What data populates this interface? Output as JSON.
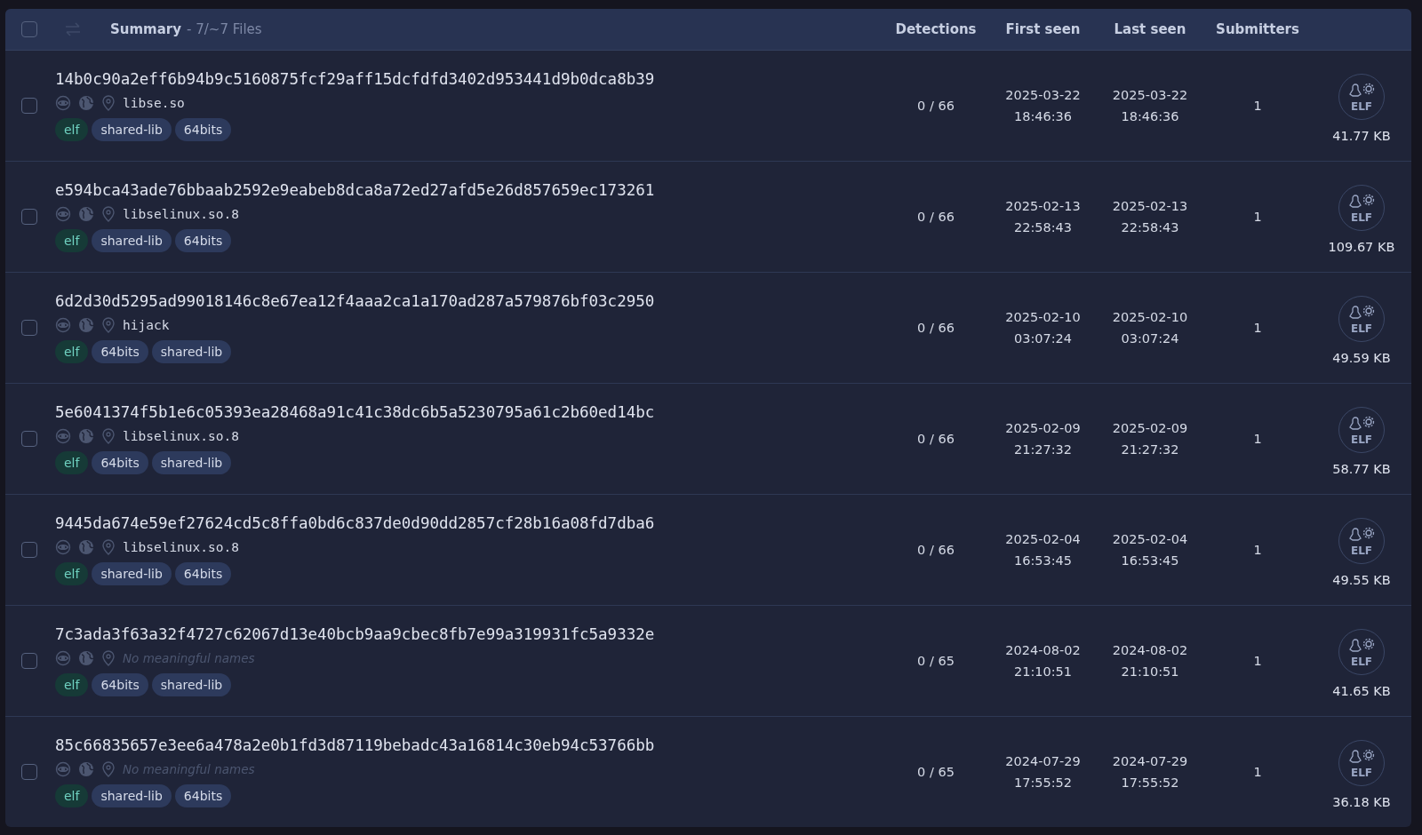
{
  "header": {
    "select_all": {
      "checked": false
    },
    "title": "Summary",
    "count": "- 7/~7 Files",
    "columns": [
      "Detections",
      "First seen",
      "Last seen",
      "Submitters"
    ]
  },
  "rows": [
    {
      "checked": false,
      "hash": "14b0c90a2eff6b94b9c5160875fcf29aff15dcfdfd3402d953441d9b0dca8b39",
      "name": "libse.so",
      "name_missing": false,
      "tags": [
        {
          "label": "elf",
          "kind": "filetype"
        },
        {
          "label": "shared-lib",
          "kind": "tag"
        },
        {
          "label": "64bits",
          "kind": "tag"
        }
      ],
      "detections": "0 / 66",
      "first_seen": [
        "2025-03-22",
        "18:46:36"
      ],
      "last_seen": [
        "2025-03-22",
        "18:46:36"
      ],
      "submitters": "1",
      "file_type": "ELF",
      "size": "41.77 KB"
    },
    {
      "checked": false,
      "hash": "e594bca43ade76bbaab2592e9eabeb8dca8a72ed27afd5e26d857659ec173261",
      "name": "libselinux.so.8",
      "name_missing": false,
      "tags": [
        {
          "label": "elf",
          "kind": "filetype"
        },
        {
          "label": "shared-lib",
          "kind": "tag"
        },
        {
          "label": "64bits",
          "kind": "tag"
        }
      ],
      "detections": "0 / 66",
      "first_seen": [
        "2025-02-13",
        "22:58:43"
      ],
      "last_seen": [
        "2025-02-13",
        "22:58:43"
      ],
      "submitters": "1",
      "file_type": "ELF",
      "size": "109.67 KB"
    },
    {
      "checked": false,
      "hash": "6d2d30d5295ad99018146c8e67ea12f4aaa2ca1a170ad287a579876bf03c2950",
      "name": "hijack",
      "name_missing": false,
      "tags": [
        {
          "label": "elf",
          "kind": "filetype"
        },
        {
          "label": "64bits",
          "kind": "tag"
        },
        {
          "label": "shared-lib",
          "kind": "tag"
        }
      ],
      "detections": "0 / 66",
      "first_seen": [
        "2025-02-10",
        "03:07:24"
      ],
      "last_seen": [
        "2025-02-10",
        "03:07:24"
      ],
      "submitters": "1",
      "file_type": "ELF",
      "size": "49.59 KB"
    },
    {
      "checked": false,
      "hash": "5e6041374f5b1e6c05393ea28468a91c41c38dc6b5a5230795a61c2b60ed14bc",
      "name": "libselinux.so.8",
      "name_missing": false,
      "tags": [
        {
          "label": "elf",
          "kind": "filetype"
        },
        {
          "label": "64bits",
          "kind": "tag"
        },
        {
          "label": "shared-lib",
          "kind": "tag"
        }
      ],
      "detections": "0 / 66",
      "first_seen": [
        "2025-02-09",
        "21:27:32"
      ],
      "last_seen": [
        "2025-02-09",
        "21:27:32"
      ],
      "submitters": "1",
      "file_type": "ELF",
      "size": "58.77 KB"
    },
    {
      "checked": false,
      "hash": "9445da674e59ef27624cd5c8ffa0bd6c837de0d90dd2857cf28b16a08fd7dba6",
      "name": "libselinux.so.8",
      "name_missing": false,
      "tags": [
        {
          "label": "elf",
          "kind": "filetype"
        },
        {
          "label": "shared-lib",
          "kind": "tag"
        },
        {
          "label": "64bits",
          "kind": "tag"
        }
      ],
      "detections": "0 / 66",
      "first_seen": [
        "2025-02-04",
        "16:53:45"
      ],
      "last_seen": [
        "2025-02-04",
        "16:53:45"
      ],
      "submitters": "1",
      "file_type": "ELF",
      "size": "49.55 KB"
    },
    {
      "checked": false,
      "hash": "7c3ada3f63a32f4727c62067d13e40bcb9aa9cbec8fb7e99a319931fc5a9332e",
      "name": "No meaningful names",
      "name_missing": true,
      "tags": [
        {
          "label": "elf",
          "kind": "filetype"
        },
        {
          "label": "64bits",
          "kind": "tag"
        },
        {
          "label": "shared-lib",
          "kind": "tag"
        }
      ],
      "detections": "0 / 65",
      "first_seen": [
        "2024-08-02",
        "21:10:51"
      ],
      "last_seen": [
        "2024-08-02",
        "21:10:51"
      ],
      "submitters": "1",
      "file_type": "ELF",
      "size": "41.65 KB"
    },
    {
      "checked": false,
      "hash": "85c66835657e3ee6a478a2e0b1fd3d87119bebadc43a16814c30eb94c53766bb",
      "name": "No meaningful names",
      "name_missing": true,
      "tags": [
        {
          "label": "elf",
          "kind": "filetype"
        },
        {
          "label": "shared-lib",
          "kind": "tag"
        },
        {
          "label": "64bits",
          "kind": "tag"
        }
      ],
      "detections": "0 / 65",
      "first_seen": [
        "2024-07-29",
        "17:55:52"
      ],
      "last_seen": [
        "2024-07-29",
        "17:55:52"
      ],
      "submitters": "1",
      "file_type": "ELF",
      "size": "36.18 KB"
    }
  ]
}
